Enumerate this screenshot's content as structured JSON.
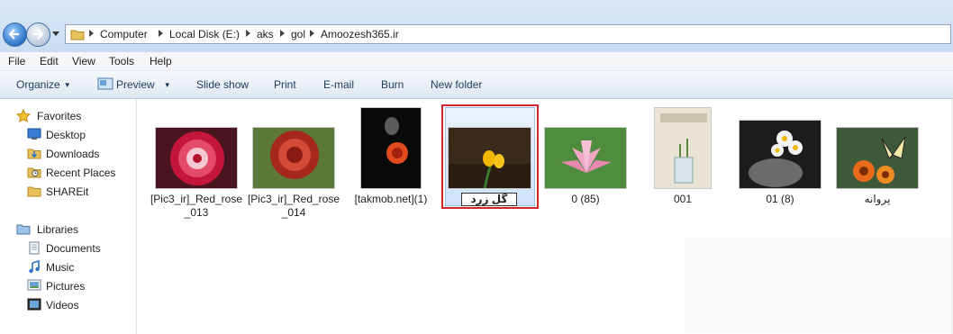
{
  "address_bar": {
    "crumbs": [
      "Computer",
      "Local Disk (E:)",
      "aks",
      "gol",
      "Amoozesh365.ir"
    ]
  },
  "menu": {
    "items": [
      "File",
      "Edit",
      "View",
      "Tools",
      "Help"
    ]
  },
  "toolbar": {
    "organize": "Organize",
    "preview": "Preview",
    "slideshow": "Slide show",
    "print": "Print",
    "email": "E-mail",
    "burn": "Burn",
    "new_folder": "New folder"
  },
  "nav": {
    "favorites_label": "Favorites",
    "favorites": [
      "Desktop",
      "Downloads",
      "Recent Places",
      "SHAREit"
    ],
    "libraries_label": "Libraries",
    "libraries": [
      "Documents",
      "Music",
      "Pictures",
      "Videos"
    ]
  },
  "files": [
    {
      "name": "[Pic3_ir]_Red_rose_013"
    },
    {
      "name": "[Pic3_ir]_Red_rose_014"
    },
    {
      "name": "[takmob.net](1)"
    },
    {
      "name": "گل زرد"
    },
    {
      "name": "0 (85)"
    },
    {
      "name": "001"
    },
    {
      "name": "01 (8)"
    },
    {
      "name": "پروانه"
    }
  ],
  "colors": {
    "selection_highlight": "#d3262a",
    "accent": "#2b73c6"
  }
}
